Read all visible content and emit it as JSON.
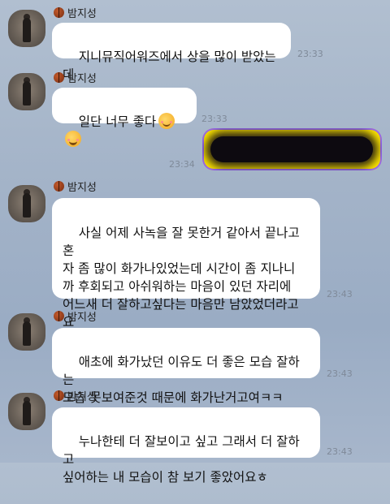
{
  "chat": {
    "messages": [
      {
        "sender": "밤지성",
        "text": "지니뮤직어워즈에서 상을 많이 받았는데",
        "time": "23:33"
      },
      {
        "sender": "밤지성",
        "text": "일단 너무 좋다",
        "emojis": [
          "smiling-blush-icon",
          "grinning-squint-icon"
        ],
        "time": "23:33"
      },
      {
        "outgoing": true,
        "text_redacted": true,
        "time": "23:34"
      },
      {
        "sender": "밤지성",
        "text": "사실 어제 사녹을 잘 못한거 같아서 끝나고 혼\n자 좀 많이 화가나있었는데 시간이 좀 지나니\n까 후회되고 아쉬워하는 마음이 있던 자리에\n어느새 더 잘하고싶다는 마음만 남았었더라고\n요",
        "time": "23:43"
      },
      {
        "sender": "밤지성",
        "text": "애초에 화가났던 이유도 더 좋은 모습 잘하는\n모습 못보여준것 때문에 화가난거고여ㅋㅋ",
        "time": "23:43"
      },
      {
        "sender": "밤지성",
        "text": "누나한테 더 잘보이고 싶고 그래서 더 잘하고\n싶어하는 내 모습이 참 보기 좋았어요ㅎ",
        "time": "23:43"
      }
    ]
  },
  "colors": {
    "background": "#a3b3c8",
    "bubble_in": "#ffffff",
    "bubble_out": "#fee500",
    "time_text": "#7f8a99"
  }
}
